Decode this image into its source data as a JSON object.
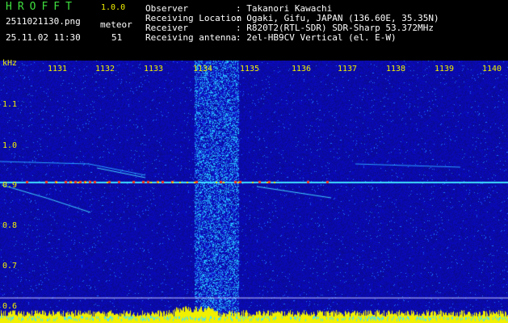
{
  "header": {
    "app_title": "HROFFT",
    "version": "1.0.0",
    "filename": "2511021130.png",
    "meteor_label": "meteor",
    "datetime": "25.11.02 11:30",
    "meteor_count": "51",
    "fields": [
      {
        "label": "Observer",
        "value": ": Takanori Kawachi"
      },
      {
        "label": "Receiving Location",
        "value": ": Ogaki, Gifu, JAPAN (136.60E, 35.35N)"
      },
      {
        "label": "Receiver",
        "value": ": R820T2(RTL-SDR) SDR-Sharp 53.372MHz"
      },
      {
        "label": "Receiving antenna",
        "value": ": 2el-HB9CV Vertical (el. E-W)"
      }
    ]
  },
  "axes": {
    "y_unit": "kHz",
    "x_ticks": [
      "1131",
      "1132",
      "1133",
      "1134",
      "1135",
      "1136",
      "1137",
      "1138",
      "1139",
      "1140"
    ],
    "y_ticks": [
      "1.1",
      "1.0",
      "0.9",
      "0.8",
      "0.7",
      "0.6"
    ]
  },
  "colors": {
    "text_primary": "#3fe03f",
    "text_secondary": "#f0f000",
    "background": "#000000",
    "waterfall_base": "#0a0a9a",
    "signal": "#40e0ff",
    "strong_signal": "#ff3a1a"
  }
}
